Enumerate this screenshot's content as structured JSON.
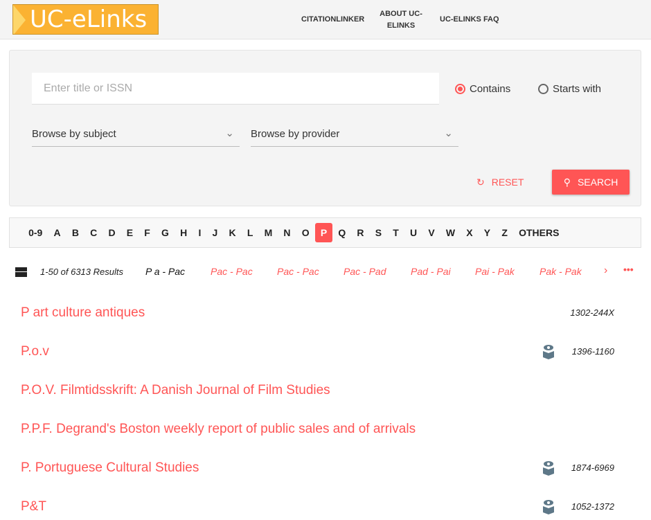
{
  "header": {
    "logo": "UC-eLinks",
    "nav": [
      "CITATIONLINKER",
      "ABOUT UC-ELINKS",
      "UC-ELINKS FAQ"
    ]
  },
  "search": {
    "placeholder": "Enter title or ISSN",
    "value": "",
    "radio_contains": "Contains",
    "radio_starts": "Starts with",
    "selected": "Contains",
    "subject": "Browse by subject",
    "provider": "Browse by provider",
    "reset": "RESET",
    "search": "SEARCH"
  },
  "alphabet": {
    "letters": [
      "0-9",
      "A",
      "B",
      "C",
      "D",
      "E",
      "F",
      "G",
      "H",
      "I",
      "J",
      "K",
      "L",
      "M",
      "N",
      "O",
      "P",
      "Q",
      "R",
      "S",
      "T",
      "U",
      "V",
      "W",
      "X",
      "Y",
      "Z",
      "OTHERS"
    ],
    "active": "P"
  },
  "pager": {
    "count": "1-50 of 6313 Results",
    "current": "P a - Pac",
    "ranges": [
      "Pac - Pac",
      "Pac - Pac",
      "Pac - Pad",
      "Pad - Pai",
      "Pai - Pak",
      "Pak - Pak"
    ]
  },
  "results": [
    {
      "title": "P art culture antiques",
      "issn": "1302-244X",
      "icon": false
    },
    {
      "title": "P.o.v",
      "issn": "1396-1160",
      "icon": true
    },
    {
      "title": "P.O.V. Filmtidsskrift: A Danish Journal of Film Studies",
      "issn": "",
      "icon": false
    },
    {
      "title": "P.P.F. Degrand's Boston weekly report of public sales and of arrivals",
      "issn": "",
      "icon": false
    },
    {
      "title": "P. Portuguese Cultural Studies",
      "issn": "1874-6969",
      "icon": true
    },
    {
      "title": "P&T",
      "issn": "1052-1372",
      "icon": true
    }
  ],
  "colors": {
    "accent": "#ff5555",
    "logo": "#fbb232"
  }
}
